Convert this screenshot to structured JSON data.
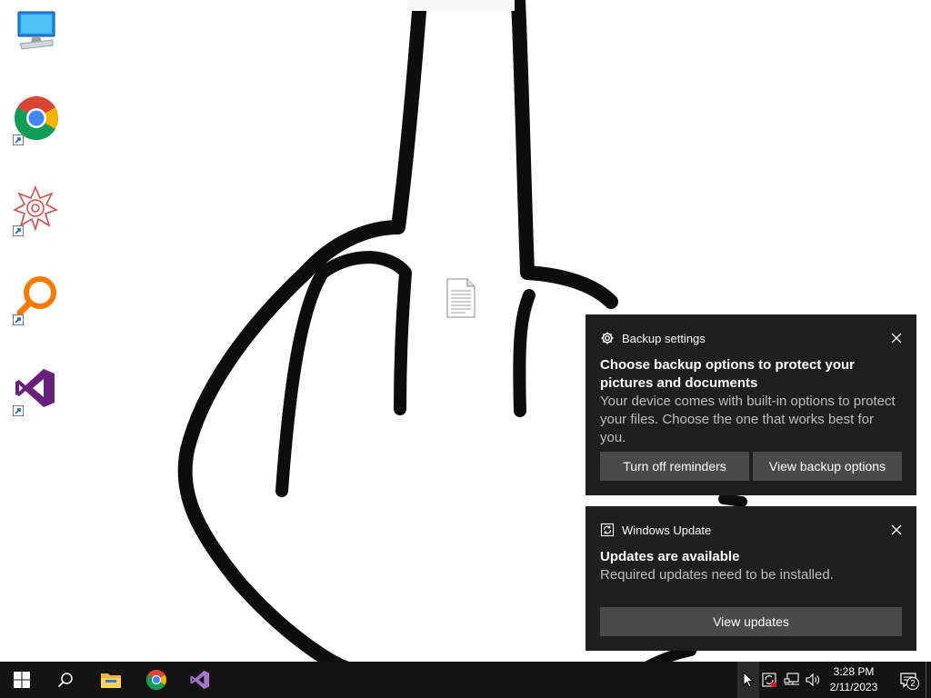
{
  "desktop": {
    "icons": [
      {
        "name": "This PC",
        "icon": "computer-icon"
      },
      {
        "name": "Google Chrome",
        "icon": "chrome-icon"
      },
      {
        "name": "Wolfram Mathematica",
        "icon": "mathematica-icon"
      },
      {
        "name": "Search tool",
        "icon": "magnifier-icon"
      },
      {
        "name": "Visual Studio",
        "icon": "visual-studio-icon"
      }
    ],
    "center_file_icon": "text-document-icon"
  },
  "notifications": {
    "backup": {
      "app_name": "Backup settings",
      "title": "Choose backup options to protect your pictures and documents",
      "body": "Your device comes with built-in options to protect your files. Choose the one that works best for you.",
      "button_primary": "Turn off reminders",
      "button_secondary": "View backup options"
    },
    "update": {
      "app_name": "Windows Update",
      "title": "Updates are available",
      "body": "Required updates need to be installed.",
      "button": "View updates"
    }
  },
  "taskbar": {
    "pinned": [
      "start-icon",
      "search-icon",
      "file-explorer-icon",
      "chrome-icon",
      "visual-studio-icon"
    ],
    "tray": [
      "windows-update-icon",
      "network-icon",
      "volume-icon"
    ],
    "time": "3:28 PM",
    "date": "2/11/2023",
    "notification_count": "2"
  },
  "colors": {
    "taskbar_bg": "#141414",
    "toast_bg": "#1f1f1f",
    "toast_button_bg": "#4a4a4a",
    "wallpaper_bg": "#ffffff"
  }
}
